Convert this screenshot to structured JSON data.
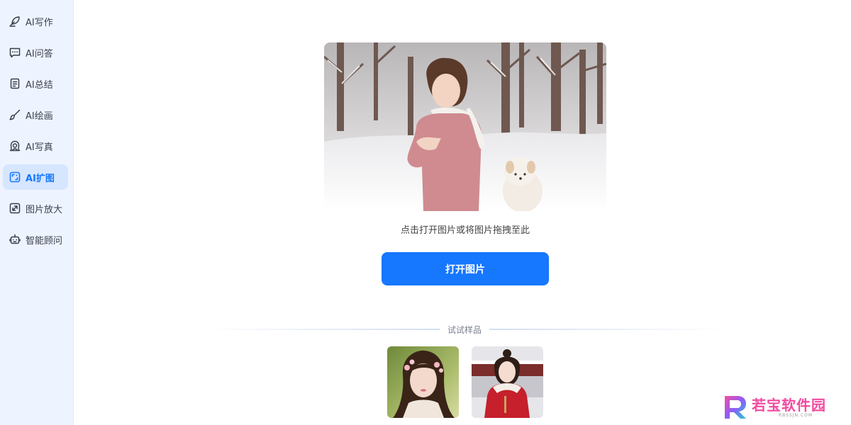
{
  "sidebar": {
    "items": [
      {
        "label": "AI写作",
        "icon": "feather-pen-icon"
      },
      {
        "label": "AI问答",
        "icon": "chat-bubble-icon"
      },
      {
        "label": "AI总结",
        "icon": "document-icon"
      },
      {
        "label": "AI绘画",
        "icon": "paintbrush-icon"
      },
      {
        "label": "AI写真",
        "icon": "portrait-icon"
      },
      {
        "label": "AI扩图",
        "icon": "image-expand-icon",
        "active": true
      },
      {
        "label": "图片放大",
        "icon": "enlarge-icon"
      },
      {
        "label": "智能顾问",
        "icon": "robot-icon"
      }
    ]
  },
  "main": {
    "hint": "点击打开图片或将图片拖拽至此",
    "open_button": "打开图片",
    "samples_title": "试试样品"
  },
  "watermark": {
    "text": "若宝软件园",
    "sub": "RBSSJN.COM"
  },
  "colors": {
    "accent": "#1677ff",
    "sidebar_bg": "#eef4ff",
    "active_bg": "#d6e6ff"
  }
}
